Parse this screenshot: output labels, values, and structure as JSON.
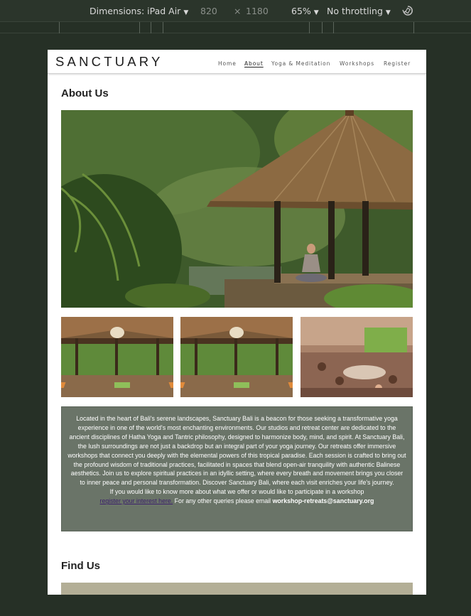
{
  "devtools": {
    "device_label": "Dimensions: iPad Air",
    "width": "820",
    "times": "×",
    "height": "1180",
    "zoom": "65%",
    "throttle": "No throttling"
  },
  "site": {
    "logo": "SANCTUARY",
    "nav": [
      {
        "label": "Home"
      },
      {
        "label": "About"
      },
      {
        "label": "Yoga & Meditation"
      },
      {
        "label": "Workshops"
      },
      {
        "label": "Register"
      }
    ]
  },
  "about": {
    "title": "About Us",
    "paragraph_1": "Located in the heart of Bali's serene landscapes, Sanctuary Bali is a beacon for those seeking a transformative yoga experience in one of the world's most enchanting environments. Our studios and retreat center are dedicated to the ancient disciplines of Hatha Yoga and Tantric philosophy, designed to harmonize body, mind, and spirit. At Sanctuary Bali, the lush surroundings are not just a backdrop but an integral part of your yoga journey. Our retreats offer immersive workshops that connect you deeply with the elemental powers of this tropical paradise. Each session is crafted to bring out the profound wisdom of traditional practices, facilitated in spaces that blend open-air tranquility with authentic Balinese aesthetics. Join us to explore spiritual practices in an idyllic setting, where every breath and movement brings you closer to inner peace and personal transformation. Discover Sanctuary Bali, where each visit enriches your life's journey.",
    "paragraph_2_prefix": "If you would like to know more about what we offer or would like to participate in a workshop",
    "register_link": "register your interest here.",
    "paragraph_2_middle": " For any other queries please email ",
    "email": "workshop-retreats@sanctuary.org"
  },
  "find": {
    "title": "Find Us"
  },
  "colors": {
    "about_box": "#6a7468",
    "map_bar": "#b3ae96",
    "link": "#3b1f6b"
  }
}
